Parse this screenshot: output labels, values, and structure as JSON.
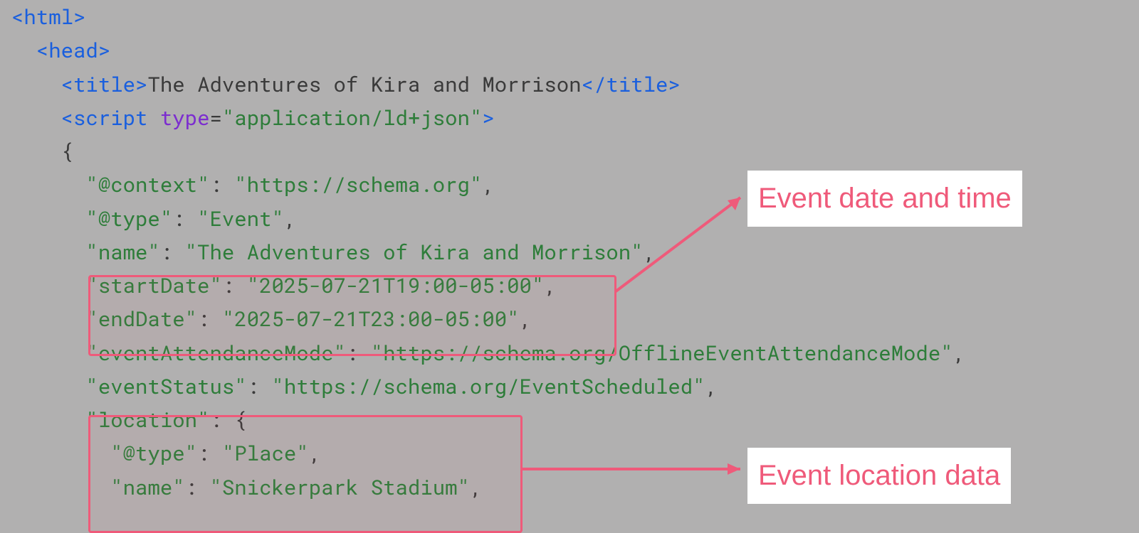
{
  "code": {
    "html_open": "<html>",
    "head_open": "<head>",
    "title_open": "<title>",
    "title_text": "The Adventures of Kira and Morrison",
    "title_close": "</title>",
    "script_open_tag": "<script",
    "script_attr_name": "type",
    "script_attr_eq": "=",
    "script_attr_val": "\"application/ld+json\"",
    "script_open_end": ">",
    "brace_open": "{",
    "context_key": "\"@context\"",
    "context_val": "\"https://schema.org\"",
    "type_key": "\"@type\"",
    "type_val": "\"Event\"",
    "name_key": "\"name\"",
    "name_val": "\"The Adventures of Kira and Morrison\"",
    "start_key": "\"startDate\"",
    "start_val": "\"2025-07-21T19:00-05:00\"",
    "end_key": "\"endDate\"",
    "end_val": "\"2025-07-21T23:00-05:00\"",
    "eam_key": "\"eventAttendanceMode\"",
    "eam_val": "\"https://schema.org/OfflineEventAttendanceMode\"",
    "status_key": "\"eventStatus\"",
    "status_val": "\"https://schema.org/EventScheduled\"",
    "loc_key": "\"location\"",
    "loc_brace": "{",
    "loc_type_key": "\"@type\"",
    "loc_type_val": "\"Place\"",
    "loc_name_key": "\"name\"",
    "loc_name_val": "\"Snickerpark Stadium\"",
    "colon": ": ",
    "comma": ","
  },
  "annotations": {
    "a1": "Event date and time",
    "a2": "Event location data"
  }
}
